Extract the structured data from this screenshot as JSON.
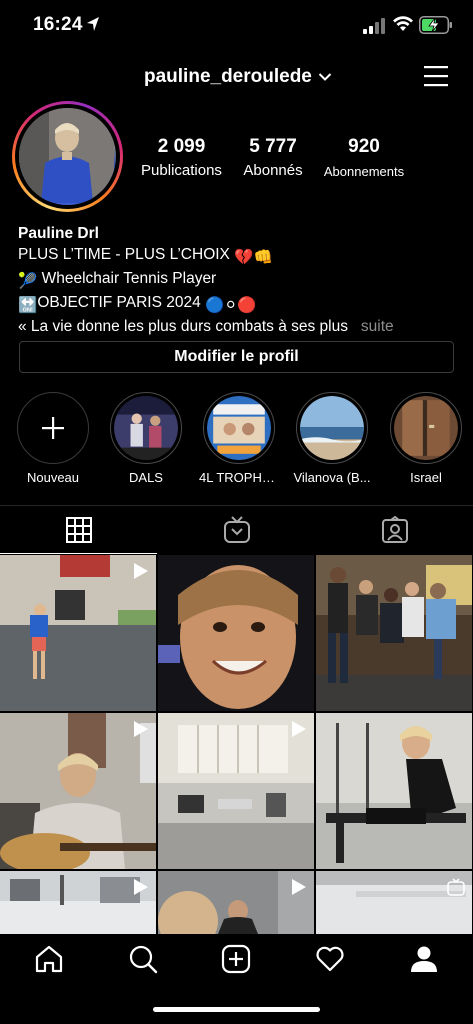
{
  "status_bar": {
    "time": "16:24"
  },
  "header": {
    "username": "pauline_deroulede"
  },
  "stats": [
    {
      "number": "2 099",
      "label": "Publications"
    },
    {
      "number": "5 777",
      "label": "Abonnés"
    },
    {
      "number": "920",
      "label": "Abonnements"
    }
  ],
  "bio": {
    "name": "Pauline Drl",
    "line1_text": "PLUS L’TIME - PLUS L’CHOIX ",
    "line1_emoji": "💔👊",
    "line2_emoji": "🎾",
    "line2_text": " Wheelchair Tennis Player",
    "line3_emoji": "🔛",
    "line3_text": "OBJECTIF PARIS 2024 ",
    "line3_flags": "🔵⚪🔴",
    "line4_text": "« La vie donne les plus durs combats à ses plus",
    "more_label": "suite"
  },
  "edit_profile_label": "Modifier le profil",
  "highlights": [
    {
      "label": "Nouveau",
      "icon": "plus-icon"
    },
    {
      "label": "DALS"
    },
    {
      "label": "4L TROPHY..."
    },
    {
      "label": "Vilanova (B..."
    },
    {
      "label": "Israel"
    }
  ],
  "tabs": [
    {
      "icon": "grid-icon",
      "active": true
    },
    {
      "icon": "igtv-icon",
      "active": false
    },
    {
      "icon": "tagged-icon",
      "active": false
    }
  ],
  "nav": [
    "home-icon",
    "search-icon",
    "new-post-icon",
    "heart-icon",
    "profile-icon"
  ],
  "colors": {
    "background": "#000000",
    "text": "#ffffff",
    "muted": "#8e8e8e",
    "border": "#262626",
    "battery": "#4cd964"
  }
}
